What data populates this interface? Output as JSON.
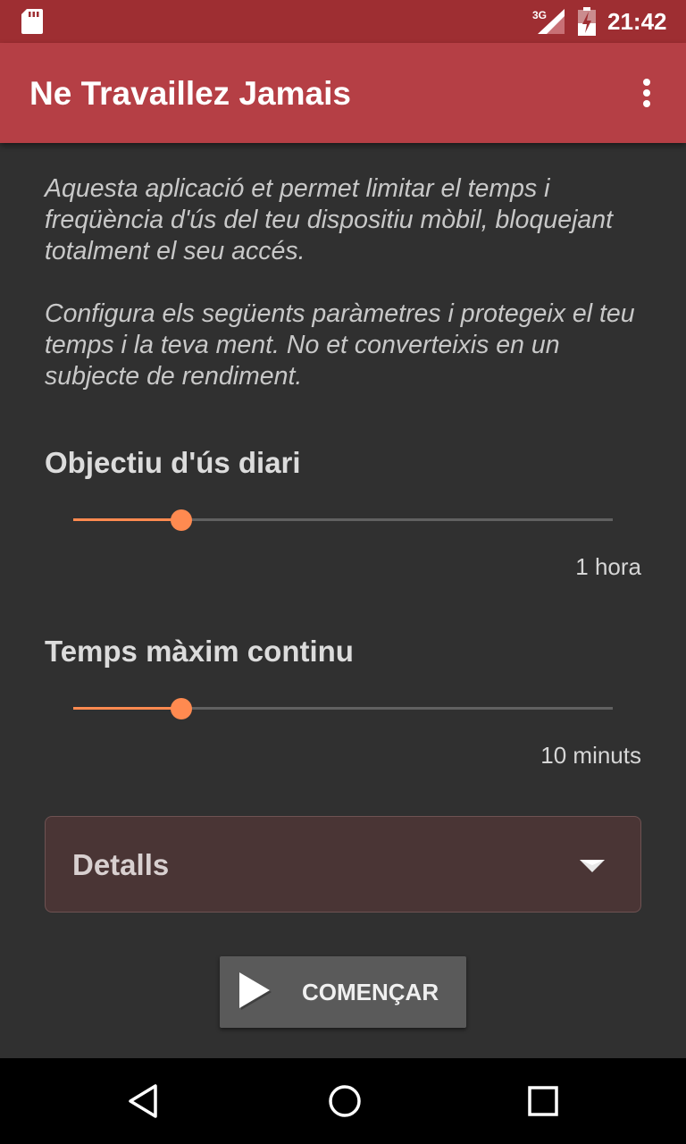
{
  "status_bar": {
    "network_label": "3G",
    "time": "21:42",
    "icons": [
      "sd-card-icon",
      "signal-icon",
      "battery-icon"
    ]
  },
  "app_bar": {
    "title": "Ne Travaillez Jamais",
    "menu_icon": "overflow-menu-icon"
  },
  "intro": {
    "paragraph_1": "Aquesta aplicació et permet limitar el temps i freqüència d'ús del teu dispositiu mòbil, bloquejant totalment el seu accés.",
    "paragraph_2": "Configura els següents paràmetres i protegeix el teu temps i la teva ment. No et converteixis en un subjecte de rendiment."
  },
  "daily_goal": {
    "title": "Objectiu d'ús diari",
    "value_label": "1 hora",
    "slider_fraction": 0.2
  },
  "max_continuous": {
    "title": "Temps màxim continu",
    "value_label": "10 minuts",
    "slider_fraction": 0.2
  },
  "details": {
    "label": "Detalls",
    "expand_icon": "chevron-down-icon"
  },
  "start_button": {
    "label": "COMENÇAR",
    "icon": "play-icon"
  },
  "nav_bar": {
    "icons": [
      "back-icon",
      "home-icon",
      "recents-icon"
    ]
  },
  "colors": {
    "status_bar": "#9e2e32",
    "app_bar": "#b53f45",
    "background": "#303030",
    "accent": "#ff8a50",
    "details_panel": "#4a3535"
  }
}
